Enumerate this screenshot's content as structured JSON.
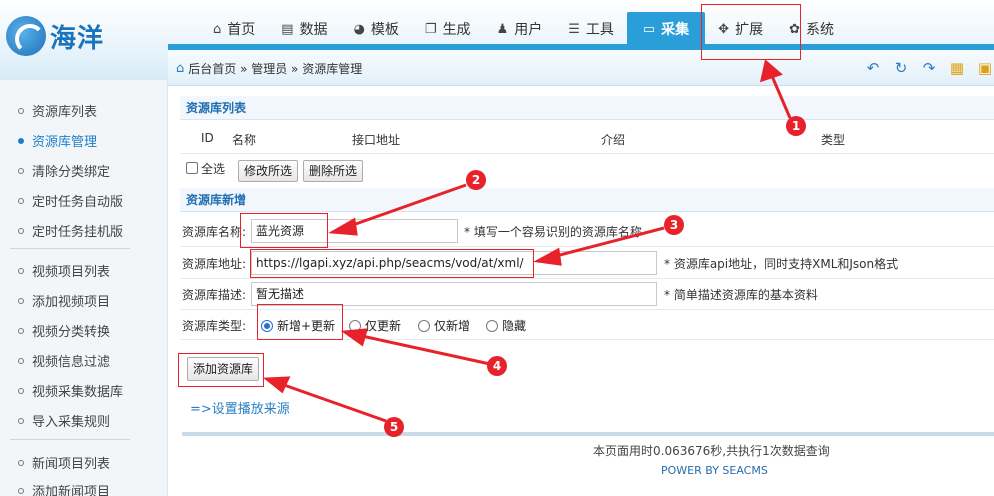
{
  "logo": {
    "text": "海洋"
  },
  "nav": [
    {
      "label": "首页",
      "icon": "home-icon",
      "glyph": "⌂"
    },
    {
      "label": "数据",
      "icon": "database-icon",
      "glyph": "▤"
    },
    {
      "label": "模板",
      "icon": "palette-icon",
      "glyph": "◕"
    },
    {
      "label": "生成",
      "icon": "copy-icon",
      "glyph": "❐"
    },
    {
      "label": "用户",
      "icon": "user-icon",
      "glyph": "♟"
    },
    {
      "label": "工具",
      "icon": "tools-icon",
      "glyph": "☰"
    },
    {
      "label": "采集",
      "icon": "monitor-icon",
      "glyph": "▭",
      "active": true
    },
    {
      "label": "扩展",
      "icon": "extend-icon",
      "glyph": "✥"
    },
    {
      "label": "系统",
      "icon": "gear-icon",
      "glyph": "✿"
    }
  ],
  "breadcrumb": {
    "text": "后台首页 » 管理员 » 资源库管理"
  },
  "sidebar": {
    "group1": [
      "资源库列表",
      "资源库管理",
      "清除分类绑定",
      "定时任务自动版",
      "定时任务挂机版"
    ],
    "group2": [
      "视频项目列表",
      "添加视频项目",
      "视频分类转换",
      "视频信息过滤",
      "视频采集数据库",
      "导入采集规则"
    ],
    "group3": [
      "新闻项目列表",
      "添加新闻项目"
    ]
  },
  "list_section": {
    "title": "资源库列表",
    "headers": {
      "id": "ID",
      "name": "名称",
      "api": "接口地址",
      "desc": "介绍",
      "type": "类型"
    },
    "select_all": "全选",
    "edit_selected": "修改所选",
    "delete_selected": "删除所选"
  },
  "add_section": {
    "title": "资源库新增",
    "name_label": "资源库名称:",
    "name_value": "蓝光资源",
    "name_hint": "* 填写一个容易识别的资源库名称",
    "api_label": "资源库地址:",
    "api_value": "https://lgapi.xyz/api.php/seacms/vod/at/xml/",
    "api_hint": "* 资源库api地址，同时支持XML和Json格式",
    "desc_label": "资源库描述:",
    "desc_value": "暂无描述",
    "desc_hint": "* 简单描述资源库的基本资料",
    "type_label": "资源库类型:",
    "type_options": [
      "新增+更新",
      "仅更新",
      "仅新增",
      "隐藏"
    ],
    "type_selected": "新增+更新",
    "submit": "添加资源库",
    "play_source_link": "=>设置播放来源"
  },
  "footer": {
    "stats": "本页面用时0.063676秒,共执行1次数据查询",
    "powered": "POWER BY SEACMS"
  },
  "annotations": [
    "1",
    "2",
    "3",
    "4",
    "5"
  ],
  "colors": {
    "accent": "#2a9ed9",
    "annotation": "#e8222a"
  }
}
